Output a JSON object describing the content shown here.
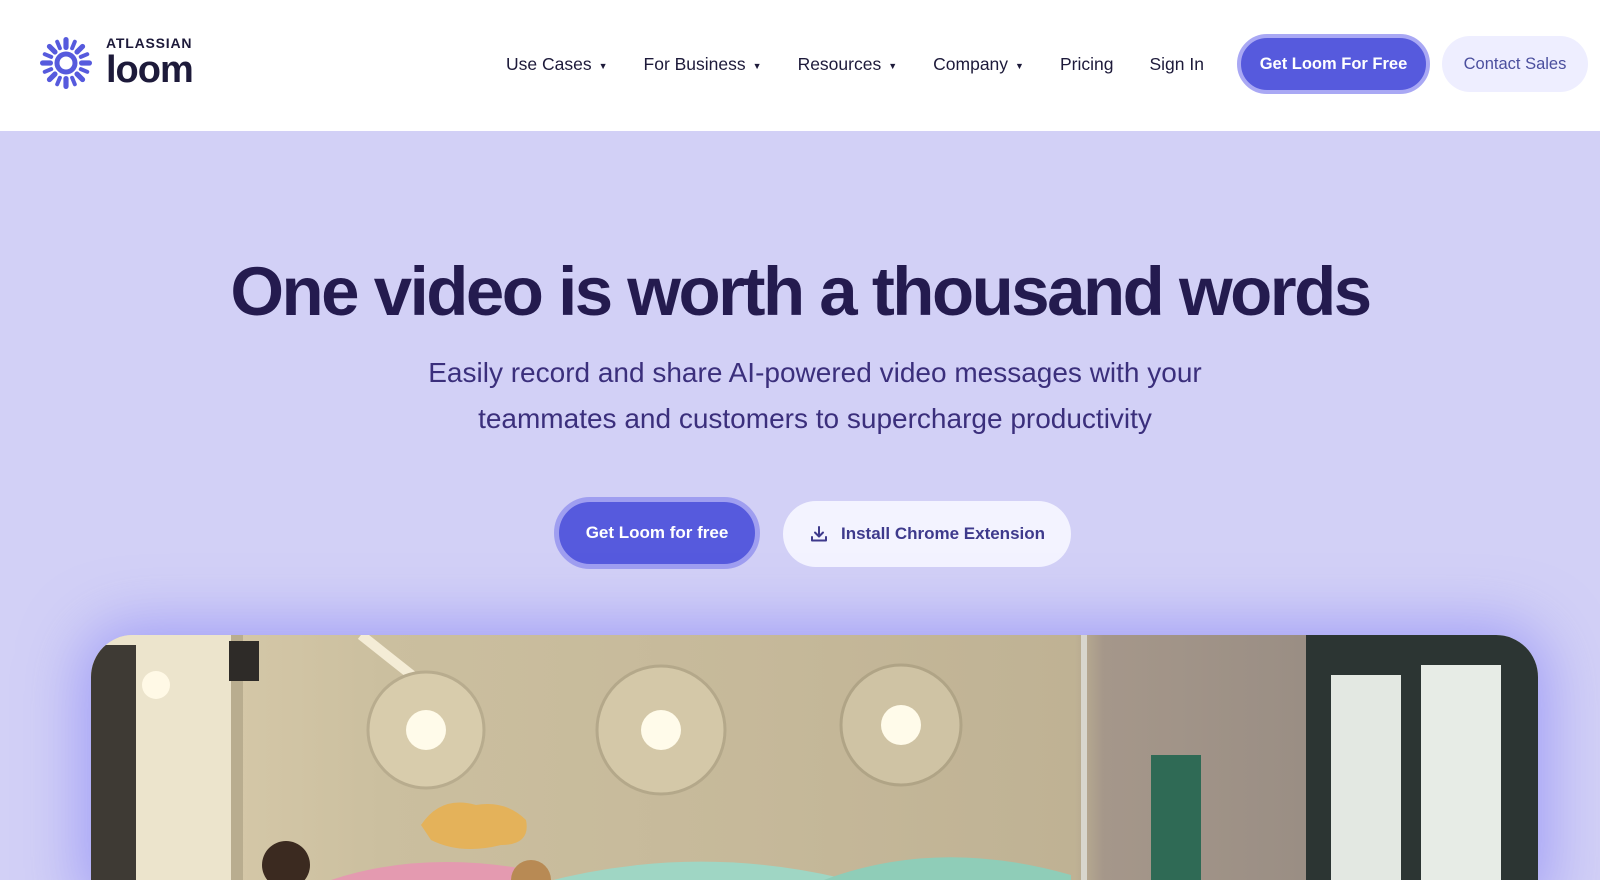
{
  "header": {
    "logo": {
      "brand_small": "ATLASSIAN",
      "brand_big": "loom",
      "icon": "loom-burst-icon"
    },
    "nav": [
      {
        "label": "Use Cases",
        "has_dropdown": true
      },
      {
        "label": "For Business",
        "has_dropdown": true
      },
      {
        "label": "Resources",
        "has_dropdown": true
      },
      {
        "label": "Company",
        "has_dropdown": true
      },
      {
        "label": "Pricing",
        "has_dropdown": false
      },
      {
        "label": "Sign In",
        "has_dropdown": false
      }
    ],
    "dropdown_caret": "▼",
    "cta_primary": "Get Loom For Free",
    "cta_secondary": "Contact Sales"
  },
  "hero": {
    "title": "One video is worth a thousand words",
    "subtitle_line1": "Easily record and share AI-powered video messages with your",
    "subtitle_line2": "teammates and customers to supercharge productivity",
    "cta_main": "Get Loom for free",
    "cta_chrome": "Install Chrome Extension",
    "cta_chrome_icon": "download-icon"
  },
  "colors": {
    "brand": "#565add",
    "hero_bg": "#d2d0f6",
    "title": "#241b4f"
  }
}
